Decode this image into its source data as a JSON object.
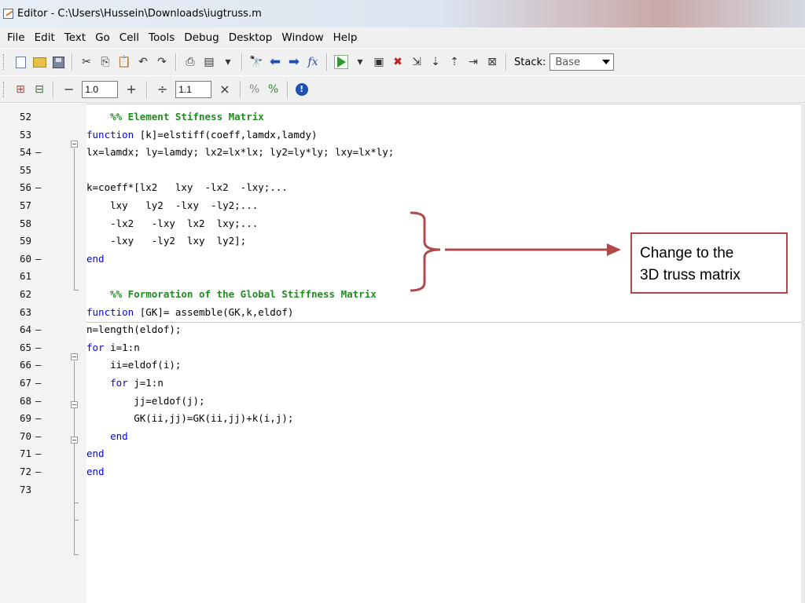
{
  "window": {
    "title": "Editor - C:\\Users\\Hussein\\Downloads\\iugtruss.m"
  },
  "menu": [
    "File",
    "Edit",
    "Text",
    "Go",
    "Cell",
    "Tools",
    "Debug",
    "Desktop",
    "Window",
    "Help"
  ],
  "toolbar": {
    "stack_label": "Stack:",
    "stack_value": "Base",
    "fx_label": "fx",
    "minus_label": "−",
    "plus_label": "+",
    "divide_label": "÷",
    "times_label": "×",
    "cell_value_1": "1.0",
    "cell_value_2": "1.1"
  },
  "editor": {
    "lines": [
      {
        "num": "52",
        "dash": "",
        "code": "    %% Element Stifness Matrix"
      },
      {
        "num": "53",
        "dash": "",
        "code": "function [k]=elstiff(coeff,lamdx,lamdy)"
      },
      {
        "num": "54",
        "dash": "–",
        "code": "lx=lamdx; ly=lamdy; lx2=lx*lx; ly2=ly*ly; lxy=lx*ly;"
      },
      {
        "num": "55",
        "dash": "",
        "code": ""
      },
      {
        "num": "56",
        "dash": "–",
        "code": "k=coeff*[lx2   lxy  -lx2  -lxy;..."
      },
      {
        "num": "57",
        "dash": "",
        "code": "    lxy   ly2  -lxy  -ly2;..."
      },
      {
        "num": "58",
        "dash": "",
        "code": "    -lx2   -lxy  lx2  lxy;..."
      },
      {
        "num": "59",
        "dash": "",
        "code": "    -lxy   -ly2  lxy  ly2];"
      },
      {
        "num": "60",
        "dash": "–",
        "code": "end"
      },
      {
        "num": "61",
        "dash": "",
        "code": ""
      },
      {
        "num": "62",
        "dash": "",
        "code": "    %% Formoration of the Global Stiffness Matrix"
      },
      {
        "num": "63",
        "dash": "",
        "code": "function [GK]= assemble(GK,k,eldof)"
      },
      {
        "num": "64",
        "dash": "–",
        "code": "n=length(eldof);"
      },
      {
        "num": "65",
        "dash": "–",
        "code": "for i=1:n"
      },
      {
        "num": "66",
        "dash": "–",
        "code": "    ii=eldof(i);"
      },
      {
        "num": "67",
        "dash": "–",
        "code": "    for j=1:n"
      },
      {
        "num": "68",
        "dash": "–",
        "code": "        jj=eldof(j);"
      },
      {
        "num": "69",
        "dash": "–",
        "code": "        GK(ii,jj)=GK(ii,jj)+k(i,j);"
      },
      {
        "num": "70",
        "dash": "–",
        "code": "    end"
      },
      {
        "num": "71",
        "dash": "–",
        "code": "end"
      },
      {
        "num": "72",
        "dash": "–",
        "code": "end"
      },
      {
        "num": "73",
        "dash": "",
        "code": ""
      }
    ]
  },
  "annotation": {
    "line1": "Change to the",
    "line2": "3D truss matrix",
    "color": "#b04a4a"
  },
  "colors": {
    "keyword": "#0000ff",
    "comment": "#228b22"
  }
}
